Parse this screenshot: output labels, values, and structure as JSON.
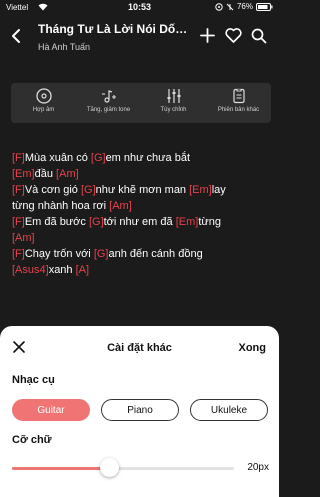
{
  "status": {
    "carrier": "Viettel",
    "time": "10:53",
    "battery": "76%"
  },
  "header": {
    "title": "Tháng Tư Là Lời Nói Dối Củ...",
    "artist": "Hà Anh Tuấn"
  },
  "toolbar": [
    {
      "label": "Hợp âm",
      "icon": "disc-icon"
    },
    {
      "label": "Tăng, giảm tone",
      "icon": "music-note-plus-minus-icon"
    },
    {
      "label": "Tùy chỉnh",
      "icon": "sliders-icon"
    },
    {
      "label": "Phiên bản khác",
      "icon": "document-icon"
    }
  ],
  "lyrics": [
    [
      {
        "c": "[F]"
      },
      {
        "t": "Mùa xuân có "
      },
      {
        "c": "[G]"
      },
      {
        "t": "em như chưa bắt"
      }
    ],
    [
      {
        "c": "[Em]"
      },
      {
        "t": "đầu "
      },
      {
        "c": "[Am]"
      }
    ],
    [
      {
        "c": "[F]"
      },
      {
        "t": "Và cơn gió "
      },
      {
        "c": "[G]"
      },
      {
        "t": "như khẽ mơn man "
      },
      {
        "c": "[Em]"
      },
      {
        "t": "lay"
      }
    ],
    [
      {
        "t": "từng nhành hoa rơi "
      },
      {
        "c": "[Am]"
      }
    ],
    [
      {
        "c": "[F]"
      },
      {
        "t": "Em đã bước "
      },
      {
        "c": "[G]"
      },
      {
        "t": "tới như em đã "
      },
      {
        "c": "[Em]"
      },
      {
        "t": "từng"
      }
    ],
    [
      {
        "c": "[Am]"
      }
    ],
    [
      {
        "c": "[F]"
      },
      {
        "t": "Chạy trốn với "
      },
      {
        "c": "[G]"
      },
      {
        "t": "anh đến cánh đồng"
      }
    ],
    [
      {
        "c": "[Asus4]"
      },
      {
        "t": "xanh "
      },
      {
        "c": "[A]"
      }
    ]
  ],
  "sheet": {
    "title": "Cài đặt khác",
    "done": "Xong",
    "instrument_label": "Nhạc cụ",
    "instruments": [
      {
        "label": "Guitar",
        "active": true
      },
      {
        "label": "Piano",
        "active": false
      },
      {
        "label": "Ukuleke",
        "active": false
      }
    ],
    "font_size_label": "Cỡ chữ",
    "font_size_value": "20px",
    "font_size_fraction": 0.44
  },
  "colors": {
    "accent": "#f07474",
    "chord": "#e8414b",
    "background": "#1b1b1b"
  }
}
